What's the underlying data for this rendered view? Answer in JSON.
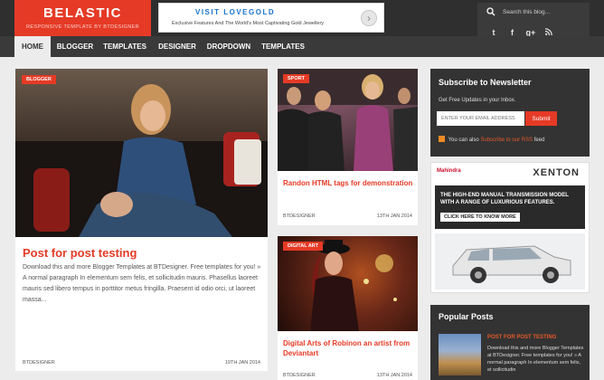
{
  "header": {
    "logo_title": "BELASTIC",
    "logo_subtitle": "RESPONSIVE TEMPLATE BY BTDESIGNER",
    "ad_title": "VISIT LOVEGOLD",
    "ad_text": "Exclusive Features And The World's Most Captivating Gold Jewellery",
    "search_placeholder": "Search this blog...",
    "social": [
      "t",
      "f",
      "g+",
      "rss"
    ]
  },
  "nav": {
    "items": [
      "HOME",
      "BLOGGER",
      "TEMPLATES",
      "DESIGNER",
      "DROPDOWN",
      "TEMPLATES"
    ]
  },
  "main_post": {
    "badge": "BLOGGER",
    "title": "Post for post testing",
    "excerpt": "Download this and more Blogger Templates at BTDesigner. Free templates for you! » A normal paragraph In elementum sem felis, et sollicitudin mauris. Phasellus laoreet mauris sed libero tempus in porttitor metus fringilla. Praesent id odio orci, ut laoreet massa...",
    "author": "BTDESIGNER",
    "date": "19TH JAN 2014"
  },
  "side_posts": [
    {
      "badge": "SPORT",
      "title": "Randon HTML tags for demonstration",
      "author": "BTDESIGNER",
      "date": "13TH JAN 2014"
    },
    {
      "badge": "DIGITAL ART",
      "title": "Digital Arts of Robinon an artist from Deviantart",
      "author": "BTDESIGNER",
      "date": "13TH JAN 2014"
    }
  ],
  "newsletter": {
    "title": "Subscribe to Newsletter",
    "desc": "Get Free Updates in your Inbox.",
    "placeholder": "ENTER YOUR EMAIL ADDRESS",
    "button": "Submit",
    "rss_prefix": "You can also",
    "rss_link": "Subscribe to our RSS",
    "rss_suffix": "feed"
  },
  "sidebar_ad": {
    "brand": "Mahindra",
    "model": "XENTON",
    "headline": "THE HIGH-END MANUAL TRANSMISSION MODEL WITH A RANGE OF LUXURIOUS FEATURES.",
    "cta": "CLICK HERE TO KNOW MORE"
  },
  "popular": {
    "title": "Popular Posts",
    "item_title": "POST FOR POST TESTING",
    "item_text": "Download this and more Blogger Templates at BTDesigner. Free templates for you! » A normal paragraph In elementum sem felis, et sollicitudin"
  },
  "colors": {
    "accent": "#e53a26",
    "dark": "#2f2f2f",
    "background": "#ececec"
  }
}
